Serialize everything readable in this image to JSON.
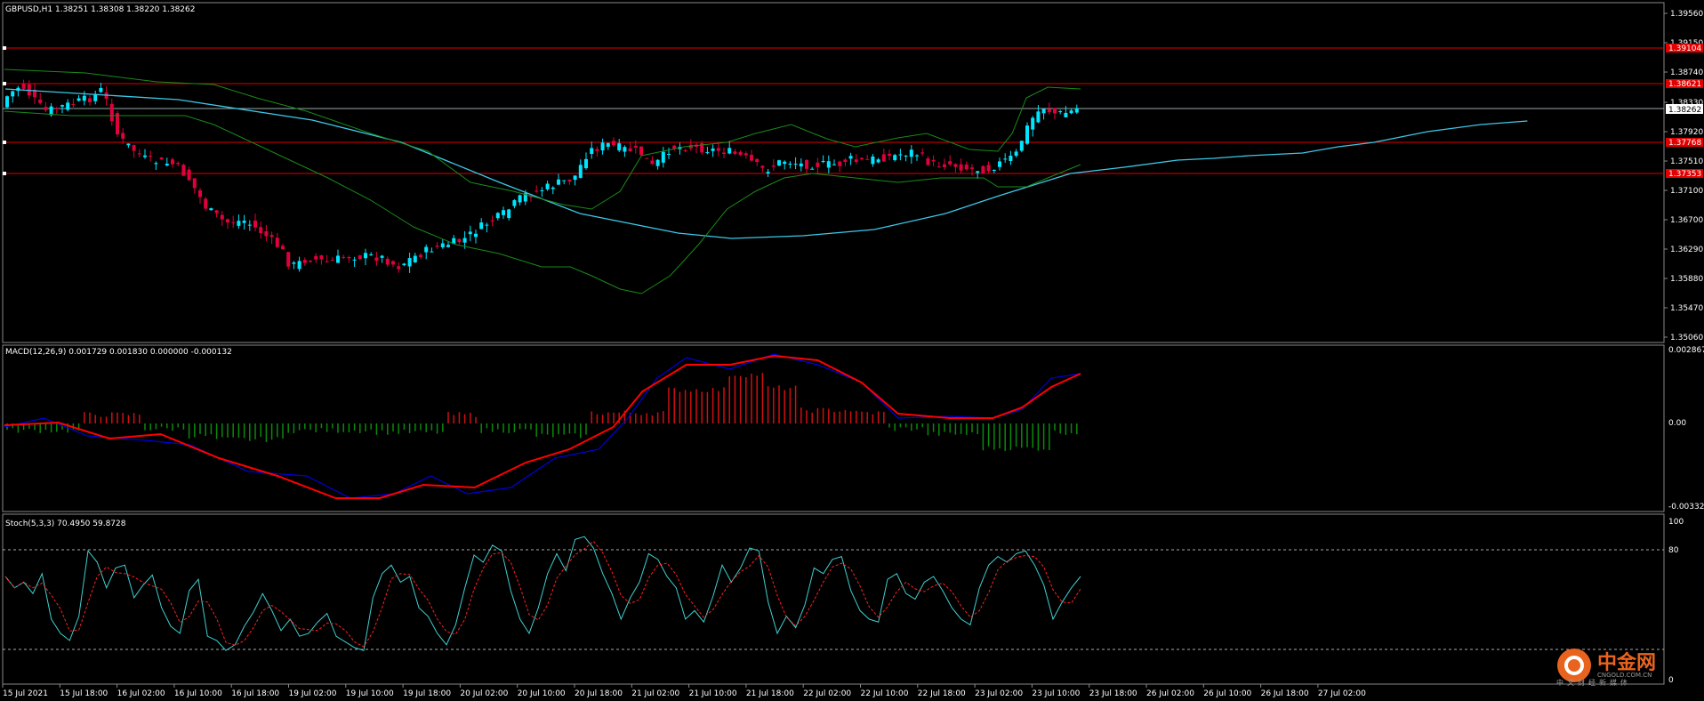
{
  "main_pane": {
    "title": "GBPUSD,H1  1.38251 1.38308 1.38220 1.38262",
    "price_axis": [
      "1.39560",
      "1.39150",
      "1.38740",
      "1.38330",
      "1.37920",
      "1.37510",
      "1.37100",
      "1.36700",
      "1.36290",
      "1.35880",
      "1.35470",
      "1.35060"
    ],
    "current_price": "1.38262",
    "levels": [
      {
        "value": "1.39104",
        "color": "#e00000"
      },
      {
        "value": "1.38621",
        "color": "#e00000"
      },
      {
        "value": "1.37768",
        "color": "#e00000"
      },
      {
        "value": "1.37353",
        "color": "#e00000"
      }
    ]
  },
  "macd_pane": {
    "title": "MACD(12,26,9) 0.001729 0.001830 0.000000 -0.000132",
    "axis": [
      "0.002867",
      "0.00",
      "-0.003322"
    ]
  },
  "stoch_pane": {
    "title": "Stoch(5,3,3) 70.4950 59.8728",
    "axis": [
      "100",
      "80",
      "0"
    ]
  },
  "time_axis": [
    "15 Jul 2021",
    "15 Jul 18:00",
    "16 Jul 02:00",
    "16 Jul 10:00",
    "16 Jul 18:00",
    "19 Jul 02:00",
    "19 Jul 10:00",
    "19 Jul 18:00",
    "20 Jul 02:00",
    "20 Jul 10:00",
    "20 Jul 18:00",
    "21 Jul 02:00",
    "21 Jul 10:00",
    "21 Jul 18:00",
    "22 Jul 02:00",
    "22 Jul 10:00",
    "22 Jul 18:00",
    "23 Jul 02:00",
    "23 Jul 10:00",
    "23 Jul 18:00",
    "26 Jul 02:00",
    "26 Jul 10:00",
    "26 Jul 18:00",
    "27 Jul 02:00"
  ],
  "colors": {
    "bull": "#00e5ff",
    "bear": "#e0003c",
    "bands": "#1a8a1a",
    "ma": "#3cc8e8",
    "macd_main": "#0000e0",
    "macd_signal": "#ff0000",
    "hist_pos": "#d01010",
    "hist_neg": "#0a8a0a",
    "stoch_main": "#40d0d0",
    "stoch_signal": "#ff2020"
  },
  "watermark": {
    "name": "中金网",
    "domain": "CNGOLD.COM.CN",
    "tagline": "中文财经新媒体"
  }
}
